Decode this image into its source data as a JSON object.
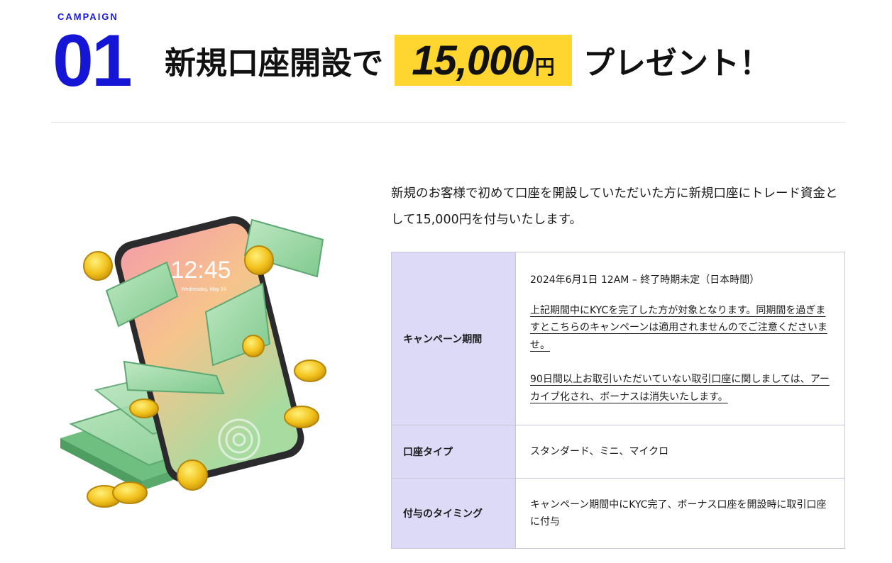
{
  "campaign": {
    "label": "CAMPAIGN",
    "number": "01"
  },
  "headline": {
    "prefix": "新規口座開設で",
    "amount": "15,000",
    "unit": "円",
    "suffix": "プレゼント！"
  },
  "intro": "新規のお客様で初めて口座を開設していただいた方に新規口座にトレード資金として15,000円を付与いたします。",
  "phone_display": {
    "time": "12:45",
    "date": "Wednesday, May 24"
  },
  "table": {
    "period": {
      "label": "キャンペーン期間",
      "date_range": "2024年6月1日 12AM – 終了時期未定（日本時間）",
      "note1": "上記期間中にKYCを完了した方が対象となります。同期間を過ぎますとこちらのキャンペーンは適用されませんのでご注意くださいませ。",
      "note2": "90日間以上お取引いただいていない取引口座に関しましては、アーカイブ化され、ボーナスは消失いたします。"
    },
    "account_type": {
      "label": "口座タイプ",
      "value": "スタンダード、ミニ、マイクロ"
    },
    "timing": {
      "label": "付与のタイミング",
      "value": "キャンペーン期間中にKYC完了、ボーナス口座を開設時に取引口座に付与"
    }
  },
  "colors": {
    "accent_blue": "#1515d6",
    "highlight_yellow": "#ffd630",
    "table_header_bg": "#dcdaf6"
  }
}
